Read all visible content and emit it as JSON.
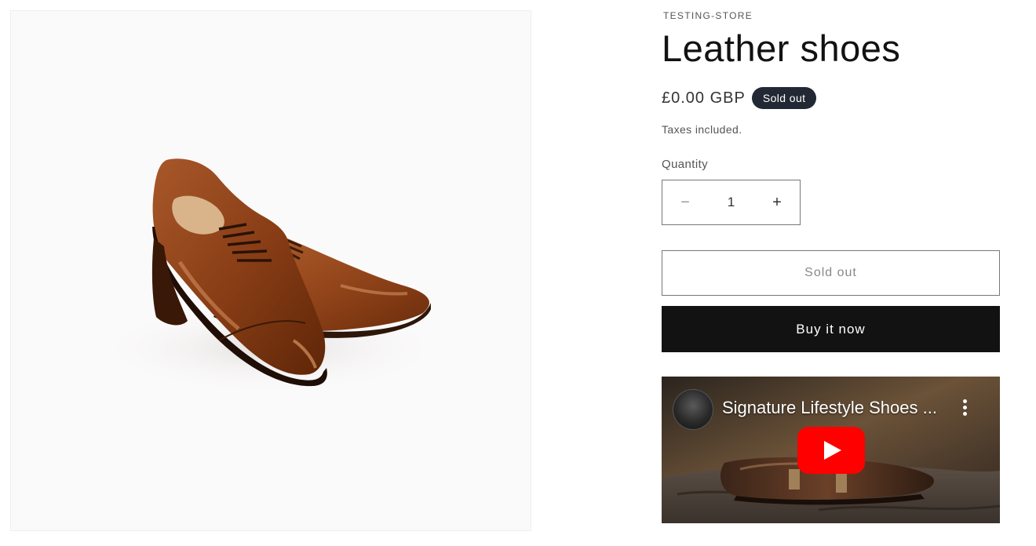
{
  "product": {
    "vendor": "TESTING-STORE",
    "title": "Leather shoes",
    "price": "£0.00 GBP",
    "badge": "Sold out",
    "taxes_note": "Taxes included.",
    "image_icon": "leather-shoes-photo"
  },
  "quantity": {
    "label": "Quantity",
    "value": "1",
    "decrease_symbol": "−",
    "increase_symbol": "+"
  },
  "buttons": {
    "sold_out_label": "Sold out",
    "buy_now_label": "Buy it now"
  },
  "video": {
    "title": "Signature Lifestyle Shoes ...",
    "play_icon": "youtube-play-icon",
    "menu_icon": "more-vertical-icon",
    "brand_color": "#ff0000"
  },
  "colors": {
    "badge_bg": "#222834",
    "buy_button_bg": "#121212",
    "media_bg": "#fbfafa"
  }
}
